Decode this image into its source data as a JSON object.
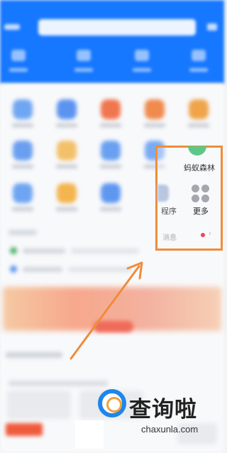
{
  "callout": {
    "forest_label": "蚂蚁森林",
    "more_label": "更多",
    "program_label": "程序",
    "messages_label": "消息",
    "messages_chevron": "›",
    "border_color": "#f08c3a"
  },
  "icons": {
    "forest": "ant-forest-icon",
    "more": "more-grid-icon"
  },
  "watermark": {
    "title": "查询啦",
    "url": "chaxunla.com",
    "brand_color": "#1e86ea",
    "accent_color": "#f0a23a"
  },
  "colors": {
    "header": "#1677ff",
    "arrow": "#f08c3a"
  }
}
